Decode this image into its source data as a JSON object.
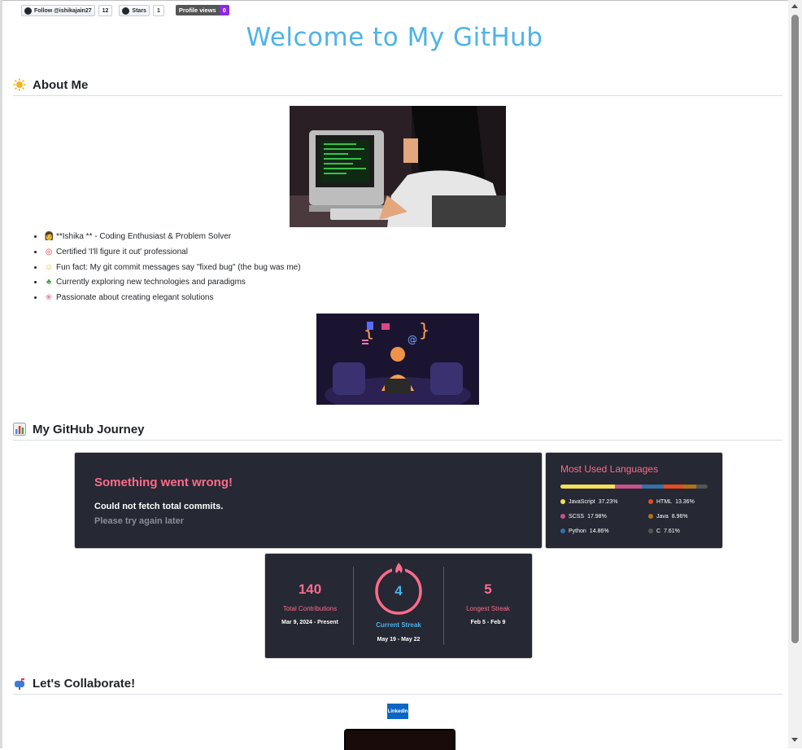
{
  "badges": {
    "follow_label": "Follow @ishikajain27",
    "follow_count": "12",
    "stars_label": "Stars",
    "stars_count": "1",
    "profile_views_label": "Profile views",
    "profile_views_count": "0"
  },
  "page": {
    "title": "Welcome to My GitHub"
  },
  "sections": {
    "about": {
      "icon": "sun-icon",
      "label": "About Me"
    },
    "journey": {
      "icon": "bar-chart-icon",
      "label": "My GitHub Journey"
    },
    "collaborate": {
      "icon": "mailbox-icon",
      "label": "Let's Collaborate!"
    }
  },
  "about": {
    "facts": [
      {
        "icon": "technologist-icon",
        "text": "**Ishika ** - Coding Enthusiast & Problem Solver"
      },
      {
        "icon": "target-icon",
        "text": "Certified 'I'll figure it out' professional"
      },
      {
        "icon": "laughing-face-icon",
        "text": "Fun fact: My git commit messages say \"fixed bug\" (the bug was me)"
      },
      {
        "icon": "seedling-icon",
        "text": "Currently exploring new technologies and paradigms"
      },
      {
        "icon": "brain-icon",
        "text": "Passionate about creating elegant solutions"
      }
    ]
  },
  "stats_error": {
    "title": "Something went wrong!",
    "message": "Could not fetch total commits.",
    "hint": "Please try again later"
  },
  "languages": {
    "title": "Most Used Languages",
    "items": [
      {
        "name": "JavaScript",
        "percent": "37.23%",
        "value": 37.23,
        "color": "#f1e05a"
      },
      {
        "name": "HTML",
        "percent": "13.36%",
        "value": 13.36,
        "color": "#e34c26"
      },
      {
        "name": "SCSS",
        "percent": "17.98%",
        "value": 17.98,
        "color": "#c6538c"
      },
      {
        "name": "Java",
        "percent": "8.96%",
        "value": 8.96,
        "color": "#b07219"
      },
      {
        "name": "Python",
        "percent": "14.86%",
        "value": 14.86,
        "color": "#3572a5"
      },
      {
        "name": "C",
        "percent": "7.61%",
        "value": 7.61,
        "color": "#555555"
      }
    ]
  },
  "streak": {
    "total": {
      "value": "140",
      "label": "Total Contributions",
      "range": "Mar 9, 2024 - Present"
    },
    "current": {
      "value": "4",
      "label": "Current Streak",
      "range": "May 19 - May 22"
    },
    "longest": {
      "value": "5",
      "label": "Longest Streak",
      "range": "Feb 5 - Feb 9"
    }
  },
  "collaborate": {
    "linkedin_label": "LinkedIn"
  }
}
